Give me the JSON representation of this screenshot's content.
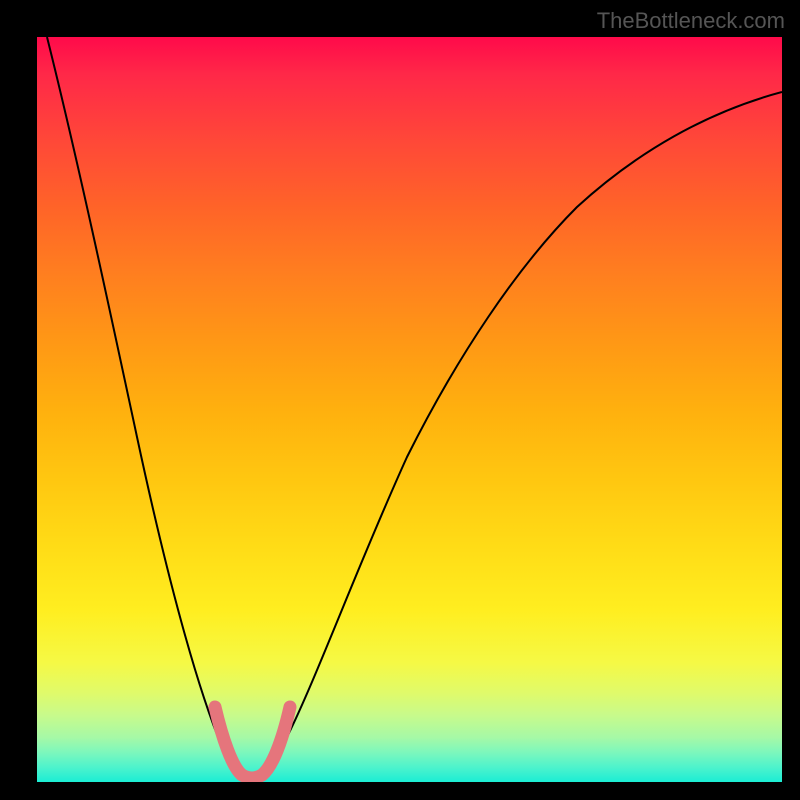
{
  "watermark": "TheBottleneck.com",
  "chart_data": {
    "type": "line",
    "title": "",
    "xlabel": "",
    "ylabel": "",
    "xlim": [
      0,
      100
    ],
    "ylim": [
      0,
      100
    ],
    "series": [
      {
        "name": "bottleneck-curve",
        "x": [
          0,
          5,
          10,
          15,
          18,
          21,
          23,
          25,
          27,
          29,
          31,
          33,
          35,
          40,
          45,
          50,
          55,
          60,
          65,
          70,
          75,
          80,
          85,
          90,
          95,
          100
        ],
        "values": [
          100,
          80,
          60,
          40,
          28,
          16,
          8,
          3,
          0,
          0,
          3,
          8,
          15,
          31,
          44,
          54,
          62,
          68,
          73,
          77,
          80,
          82.5,
          84.5,
          86,
          87,
          88
        ]
      },
      {
        "name": "optimal-zone",
        "x": [
          23,
          25,
          27,
          29,
          31,
          33
        ],
        "values": [
          8,
          3,
          0,
          0,
          3,
          8
        ]
      }
    ],
    "gradient_colors": {
      "top": "#ff0a4a",
      "middle": "#ffdb16",
      "bottom": "#1bedd4"
    },
    "pink_marker_color": "#e5757c"
  }
}
